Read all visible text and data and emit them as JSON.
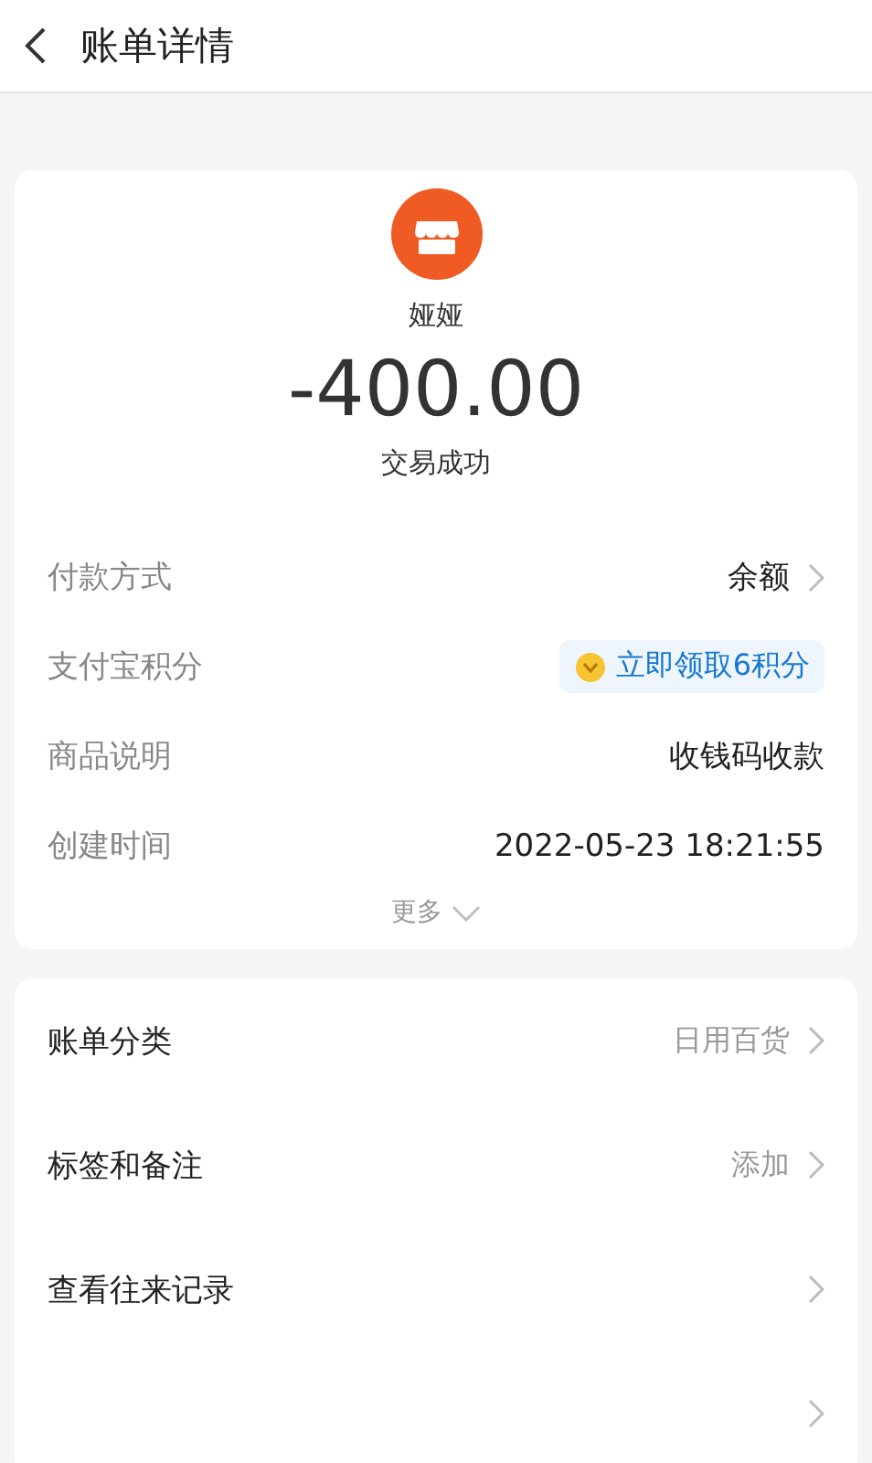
{
  "header": {
    "title": "账单详情"
  },
  "summary": {
    "name": "娅娅",
    "amount": "-400.00",
    "status": "交易成功"
  },
  "details": [
    {
      "label": "付款方式",
      "kind": "text",
      "value": "余额",
      "chevron": true
    },
    {
      "label": "支付宝积分",
      "kind": "badge",
      "value": "立即领取6积分",
      "chevron": false
    },
    {
      "label": "商品说明",
      "kind": "text",
      "value": "收钱码收款",
      "chevron": false
    },
    {
      "label": "创建时间",
      "kind": "text",
      "value": "2022-05-23 18:21:55",
      "chevron": false
    }
  ],
  "more": "更多",
  "actions": [
    {
      "label": "账单分类",
      "value": "日用百货",
      "chevron": true
    },
    {
      "label": "标签和备注",
      "value": "添加",
      "chevron": true
    },
    {
      "label": "查看往来记录",
      "chevron": true
    },
    {
      "chevron": true
    }
  ]
}
